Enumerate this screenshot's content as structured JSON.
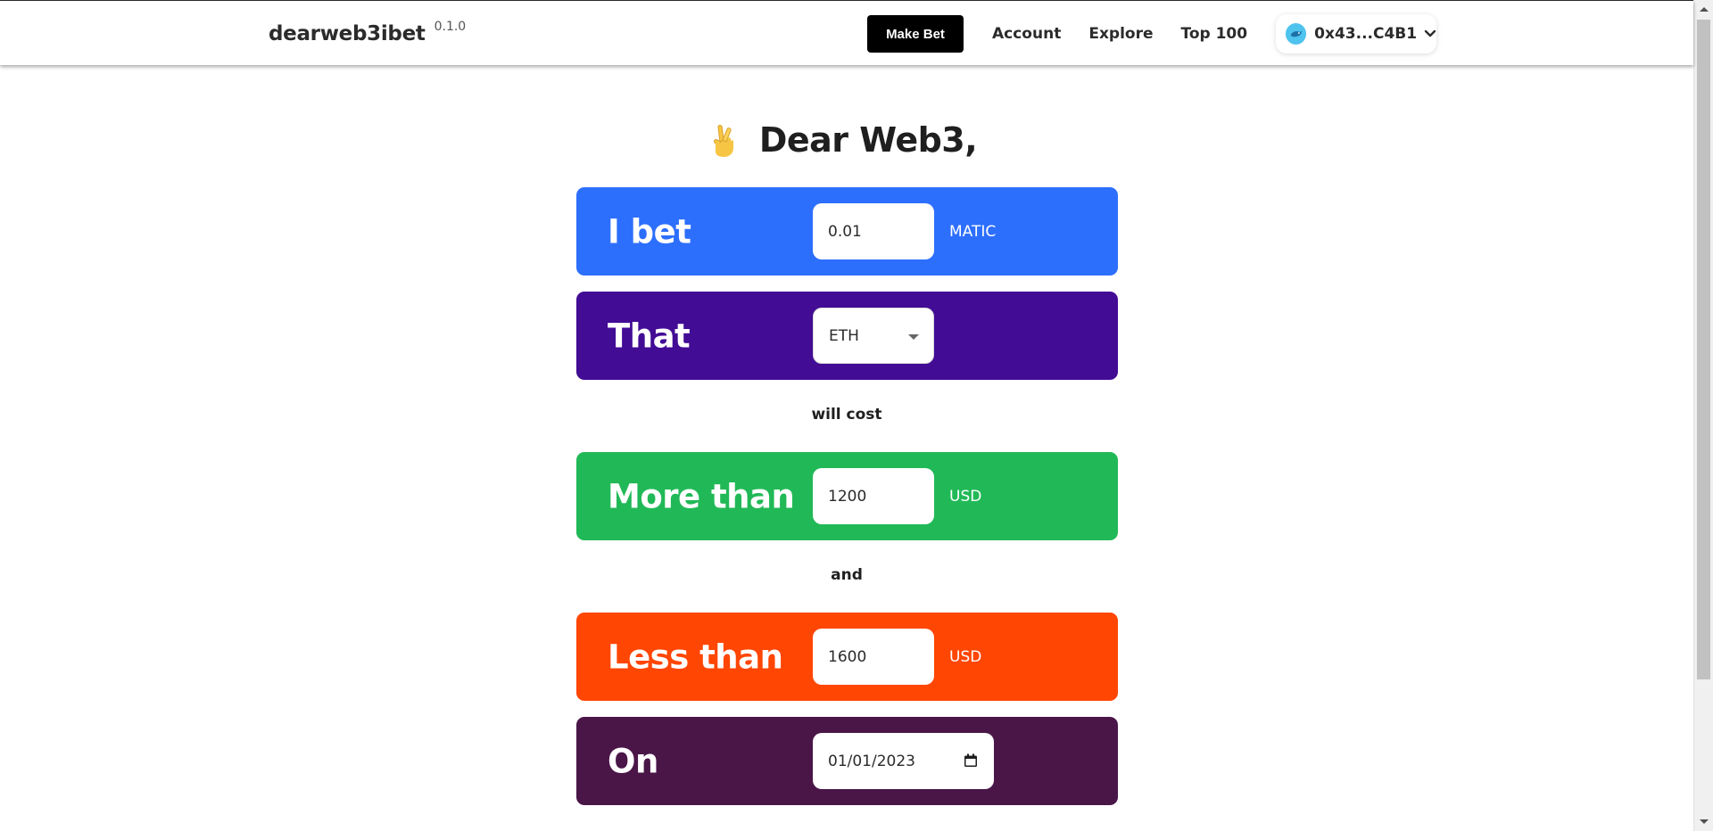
{
  "app": {
    "brand": "dearweb3ibet",
    "version": "0.1.0"
  },
  "nav": {
    "make_bet": "Make Bet",
    "account": "Account",
    "explore": "Explore",
    "top100": "Top 100",
    "wallet_address": "0x43...C4B1"
  },
  "heading": {
    "icon": "crossed-fingers",
    "text": "Dear Web3,"
  },
  "form": {
    "bet": {
      "label": "I bet",
      "amount": "0.01",
      "unit": "MATIC",
      "color": "#2d6ffd"
    },
    "asset": {
      "label": "That",
      "selected": "ETH",
      "color": "#420c95"
    },
    "connector1": "will cost",
    "lower": {
      "label": "More than",
      "value": "1200",
      "unit": "USD",
      "color": "#21b957"
    },
    "connector2": "and",
    "upper": {
      "label": "Less than",
      "value": "1600",
      "unit": "USD",
      "color": "#ff4603"
    },
    "date": {
      "label": "On",
      "value": "01/01/2023",
      "color": "#4a1648"
    }
  }
}
